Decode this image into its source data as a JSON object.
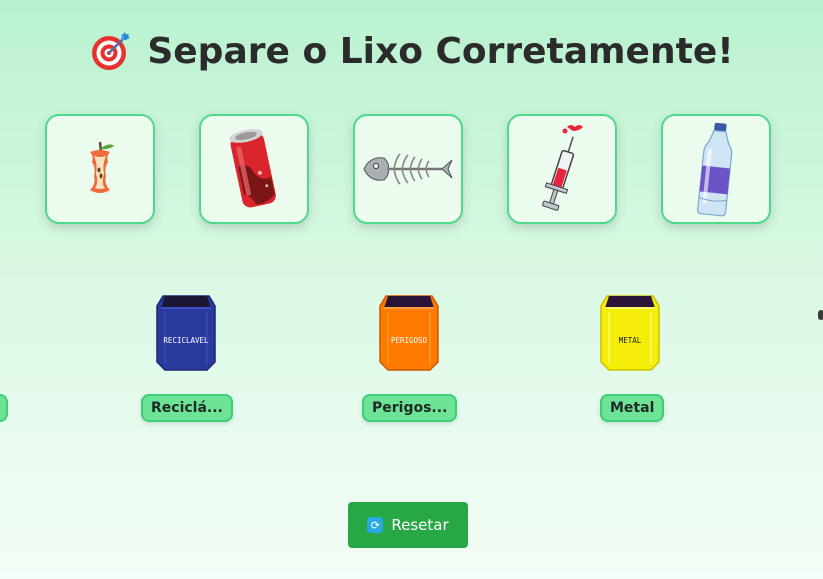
{
  "header": {
    "title": "Separe o Lixo Corretamente!",
    "icon": "target-dart-icon"
  },
  "items": [
    {
      "name": "apple-core",
      "icon": "apple-core-icon"
    },
    {
      "name": "soda-can",
      "icon": "soda-can-icon"
    },
    {
      "name": "fish-bone",
      "icon": "fish-bone-icon"
    },
    {
      "name": "syringe",
      "icon": "syringe-icon"
    },
    {
      "name": "water-bottle",
      "icon": "water-bottle-icon"
    }
  ],
  "bins": [
    {
      "sign": "RECICLAVEL",
      "label": "Reciclá...",
      "color": "#2b3a9e"
    },
    {
      "sign": "PERIGOSO",
      "label": "Perigos...",
      "color": "#ff7a00"
    },
    {
      "sign": "METAL",
      "label": "Metal",
      "color": "#f5ee0a"
    }
  ],
  "controls": {
    "reset_label": "Resetar"
  }
}
